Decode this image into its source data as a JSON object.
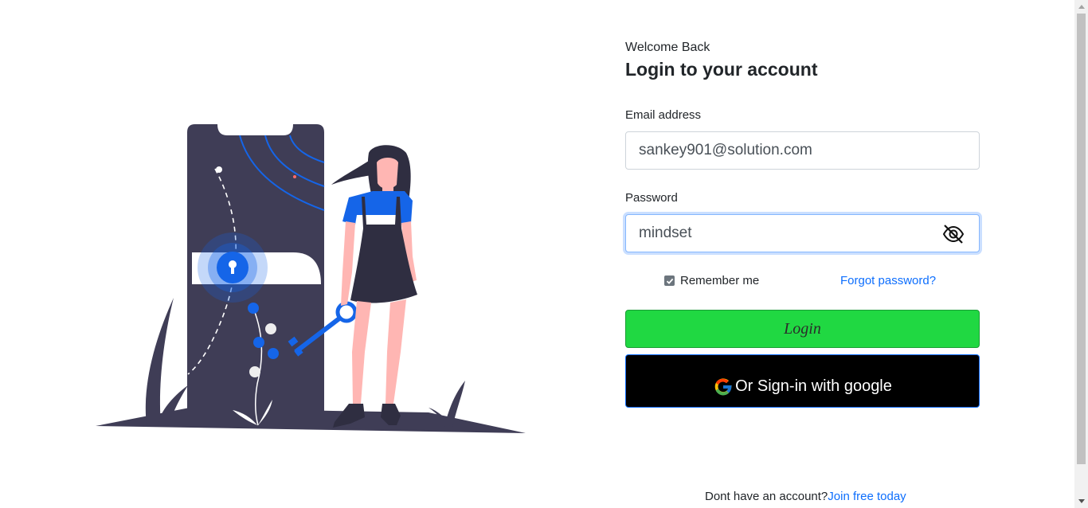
{
  "header": {
    "welcome": "Welcome Back",
    "title": "Login to your account"
  },
  "form": {
    "email_label": "Email address",
    "email_value": "sankey901@solution.com",
    "password_label": "Password",
    "password_value": "mindset",
    "remember_label": "Remember me",
    "remember_checked": true,
    "forgot_link": "Forgot password?",
    "login_button": "Login",
    "google_button": "Or Sign-in with google"
  },
  "footer": {
    "no_account_text": "Dont have an account?",
    "join_link": "Join free today"
  },
  "icons": {
    "password_toggle": "eye-slash-icon",
    "google": "google-logo-icon",
    "illustration": "login-illustration"
  },
  "colors": {
    "accent": "#0d6efd",
    "login_button": "#20d842",
    "google_button": "#000000",
    "illustration_dark": "#3f3d56",
    "illustration_blue": "#1565e8"
  }
}
